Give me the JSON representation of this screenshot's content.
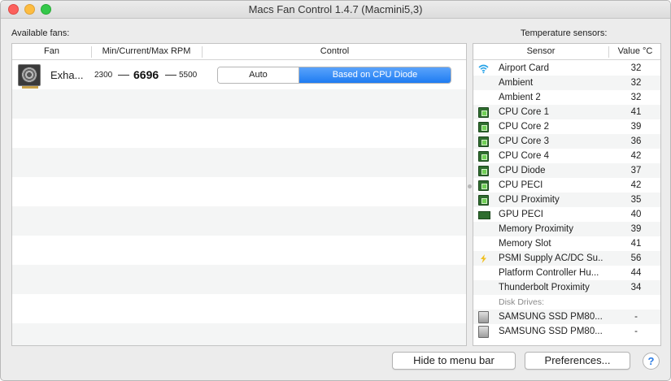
{
  "window": {
    "title": "Macs Fan Control 1.4.7 (Macmini5,3)"
  },
  "fans_section": {
    "label": "Available fans:",
    "columns": {
      "fan": "Fan",
      "rpm": "Min/Current/Max RPM",
      "control": "Control"
    },
    "fans": [
      {
        "name": "Exha...",
        "min_rpm": "2300",
        "current_rpm": "6696",
        "max_rpm": "5500",
        "dash": "—",
        "control_options": [
          "Auto",
          "Based on CPU Diode"
        ],
        "selected_control": "Based on CPU Diode"
      }
    ]
  },
  "sensors_section": {
    "label": "Temperature sensors:",
    "columns": {
      "sensor": "Sensor",
      "value": "Value °C"
    },
    "sensors": [
      {
        "name": "Airport Card",
        "value": "32",
        "icon": "wifi-icon"
      },
      {
        "name": "Ambient",
        "value": "32",
        "icon": ""
      },
      {
        "name": "Ambient 2",
        "value": "32",
        "icon": ""
      },
      {
        "name": "CPU Core 1",
        "value": "41",
        "icon": "chip-icon"
      },
      {
        "name": "CPU Core 2",
        "value": "39",
        "icon": "chip-icon"
      },
      {
        "name": "CPU Core 3",
        "value": "36",
        "icon": "chip-icon"
      },
      {
        "name": "CPU Core 4",
        "value": "42",
        "icon": "chip-icon"
      },
      {
        "name": "CPU Diode",
        "value": "37",
        "icon": "chip-icon"
      },
      {
        "name": "CPU PECI",
        "value": "42",
        "icon": "chip-icon"
      },
      {
        "name": "CPU Proximity",
        "value": "35",
        "icon": "chip-icon"
      },
      {
        "name": "GPU PECI",
        "value": "40",
        "icon": "gpu-icon"
      },
      {
        "name": "Memory Proximity",
        "value": "39",
        "icon": ""
      },
      {
        "name": "Memory Slot",
        "value": "41",
        "icon": ""
      },
      {
        "name": "PSMI Supply AC/DC Su...",
        "value": "56",
        "icon": "bolt-icon"
      },
      {
        "name": "Platform Controller Hu...",
        "value": "44",
        "icon": ""
      },
      {
        "name": "Thunderbolt Proximity",
        "value": "34",
        "icon": ""
      }
    ],
    "disk_group_label": "Disk Drives:",
    "disks": [
      {
        "name": "SAMSUNG SSD PM80...",
        "value": "-",
        "icon": "disk-icon"
      },
      {
        "name": "SAMSUNG SSD PM80...",
        "value": "-",
        "icon": "disk-icon"
      }
    ]
  },
  "buttons": {
    "hide_to_menu_bar": "Hide to menu bar",
    "preferences": "Preferences...",
    "help": "?"
  }
}
